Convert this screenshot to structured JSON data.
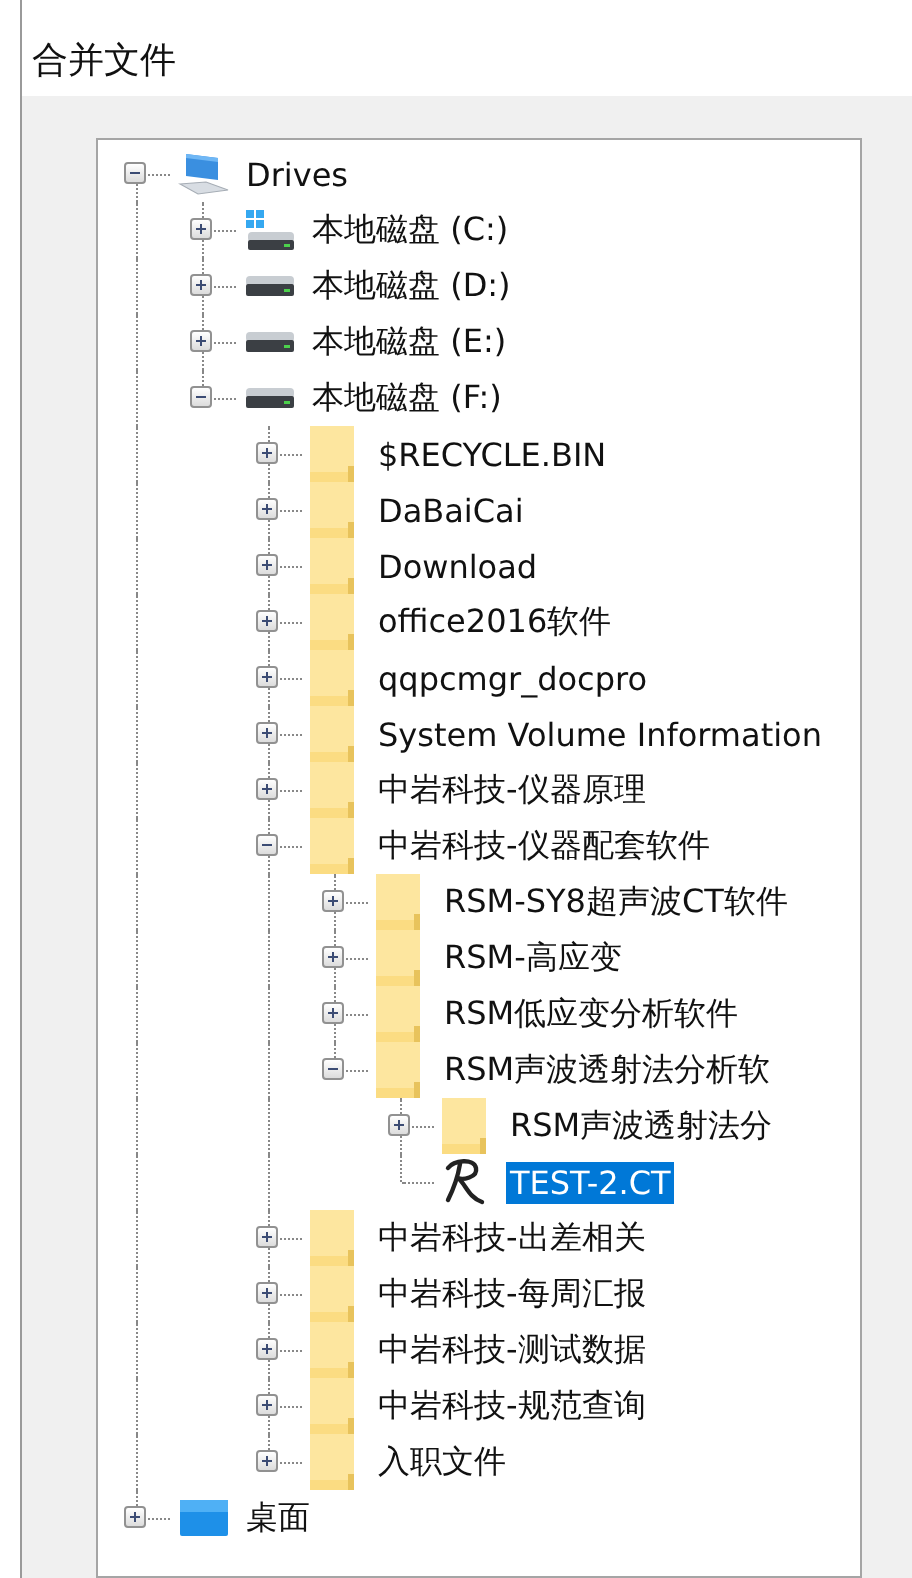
{
  "dialog": {
    "title": "合并文件"
  },
  "tree": {
    "nodes": [
      {
        "label": "Drives",
        "kind": "computer",
        "expanded": true,
        "selected": false,
        "children": [
          {
            "label": "本地磁盘 (C:)",
            "kind": "system-drive",
            "expanded": false,
            "selected": false
          },
          {
            "label": "本地磁盘 (D:)",
            "kind": "drive",
            "expanded": false,
            "selected": false
          },
          {
            "label": "本地磁盘 (E:)",
            "kind": "drive",
            "expanded": false,
            "selected": false
          },
          {
            "label": "本地磁盘 (F:)",
            "kind": "drive",
            "expanded": true,
            "selected": false,
            "children": [
              {
                "label": "$RECYCLE.BIN",
                "kind": "folder",
                "expanded": false,
                "selected": false
              },
              {
                "label": "DaBaiCai",
                "kind": "folder",
                "expanded": false,
                "selected": false
              },
              {
                "label": "Download",
                "kind": "folder",
                "expanded": false,
                "selected": false
              },
              {
                "label": "office2016软件",
                "kind": "folder",
                "expanded": false,
                "selected": false
              },
              {
                "label": "qqpcmgr_docpro",
                "kind": "folder",
                "expanded": false,
                "selected": false
              },
              {
                "label": "System Volume Information",
                "kind": "folder",
                "expanded": false,
                "selected": false
              },
              {
                "label": "中岩科技-仪器原理",
                "kind": "folder",
                "expanded": false,
                "selected": false
              },
              {
                "label": "中岩科技-仪器配套软件",
                "kind": "folder",
                "expanded": true,
                "selected": false,
                "children": [
                  {
                    "label": "RSM-SY8超声波CT软件",
                    "kind": "folder",
                    "expanded": false,
                    "selected": false
                  },
                  {
                    "label": "RSM-高应变",
                    "kind": "folder",
                    "expanded": false,
                    "selected": false
                  },
                  {
                    "label": "RSM低应变分析软件",
                    "kind": "folder",
                    "expanded": false,
                    "selected": false
                  },
                  {
                    "label": "RSM声波透射法分析软",
                    "kind": "folder",
                    "expanded": true,
                    "selected": false,
                    "children": [
                      {
                        "label": "RSM声波透射法分",
                        "kind": "folder",
                        "expanded": false,
                        "selected": false
                      },
                      {
                        "label": "TEST-2.CT",
                        "kind": "file",
                        "selected": true
                      }
                    ]
                  }
                ]
              },
              {
                "label": "中岩科技-出差相关",
                "kind": "folder",
                "expanded": false,
                "selected": false
              },
              {
                "label": "中岩科技-每周汇报",
                "kind": "folder",
                "expanded": false,
                "selected": false
              },
              {
                "label": "中岩科技-测试数据",
                "kind": "folder",
                "expanded": false,
                "selected": false
              },
              {
                "label": "中岩科技-规范查询",
                "kind": "folder",
                "expanded": false,
                "selected": false
              },
              {
                "label": "入职文件",
                "kind": "folder",
                "expanded": false,
                "selected": false
              }
            ]
          }
        ]
      },
      {
        "label": "桌面",
        "kind": "desktop",
        "expanded": false,
        "selected": false
      }
    ]
  }
}
